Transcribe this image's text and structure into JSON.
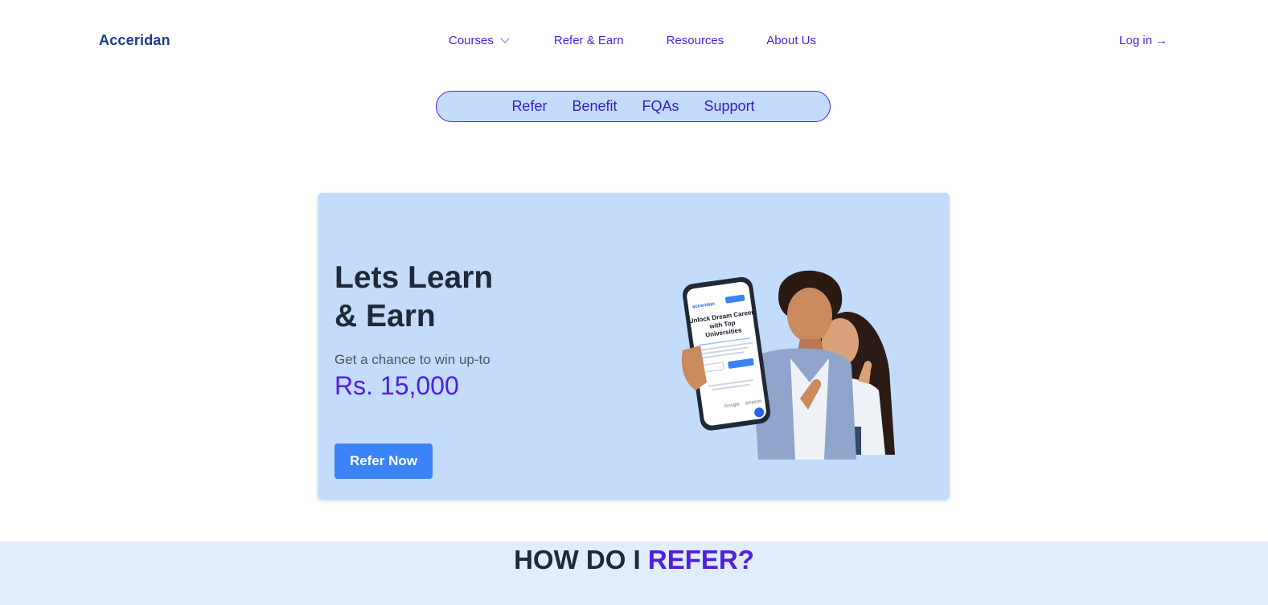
{
  "brand": "Acceridan",
  "nav": {
    "courses": "Courses",
    "refer_earn": "Refer & Earn",
    "resources": "Resources",
    "about": "About Us",
    "login": "Log in →"
  },
  "subnav": [
    "Refer",
    "Benefit",
    "FQAs",
    "Support"
  ],
  "hero": {
    "title_line1": "Lets Learn",
    "title_line2": "& Earn",
    "subtitle": "Get a chance to win up-to",
    "amount": "Rs. 15,000",
    "cta": "Refer Now"
  },
  "phone": {
    "brand": "acceridan",
    "headline_line1": "Unlock Dream Career",
    "headline_line2": "with Top",
    "headline_line3": "Universities",
    "partners": [
      "Google",
      "amazon"
    ]
  },
  "section": {
    "title_part1": "HOW DO I ",
    "title_part2": "REFER?"
  },
  "colors": {
    "accent": "#4f1ee0",
    "brand": "#1e3a8a",
    "card_bg": "#c3dcfb",
    "button": "#3b82f6",
    "section_bg": "#e0edfd"
  },
  "icons": {
    "courses_dropdown": "chevron-down-icon"
  }
}
